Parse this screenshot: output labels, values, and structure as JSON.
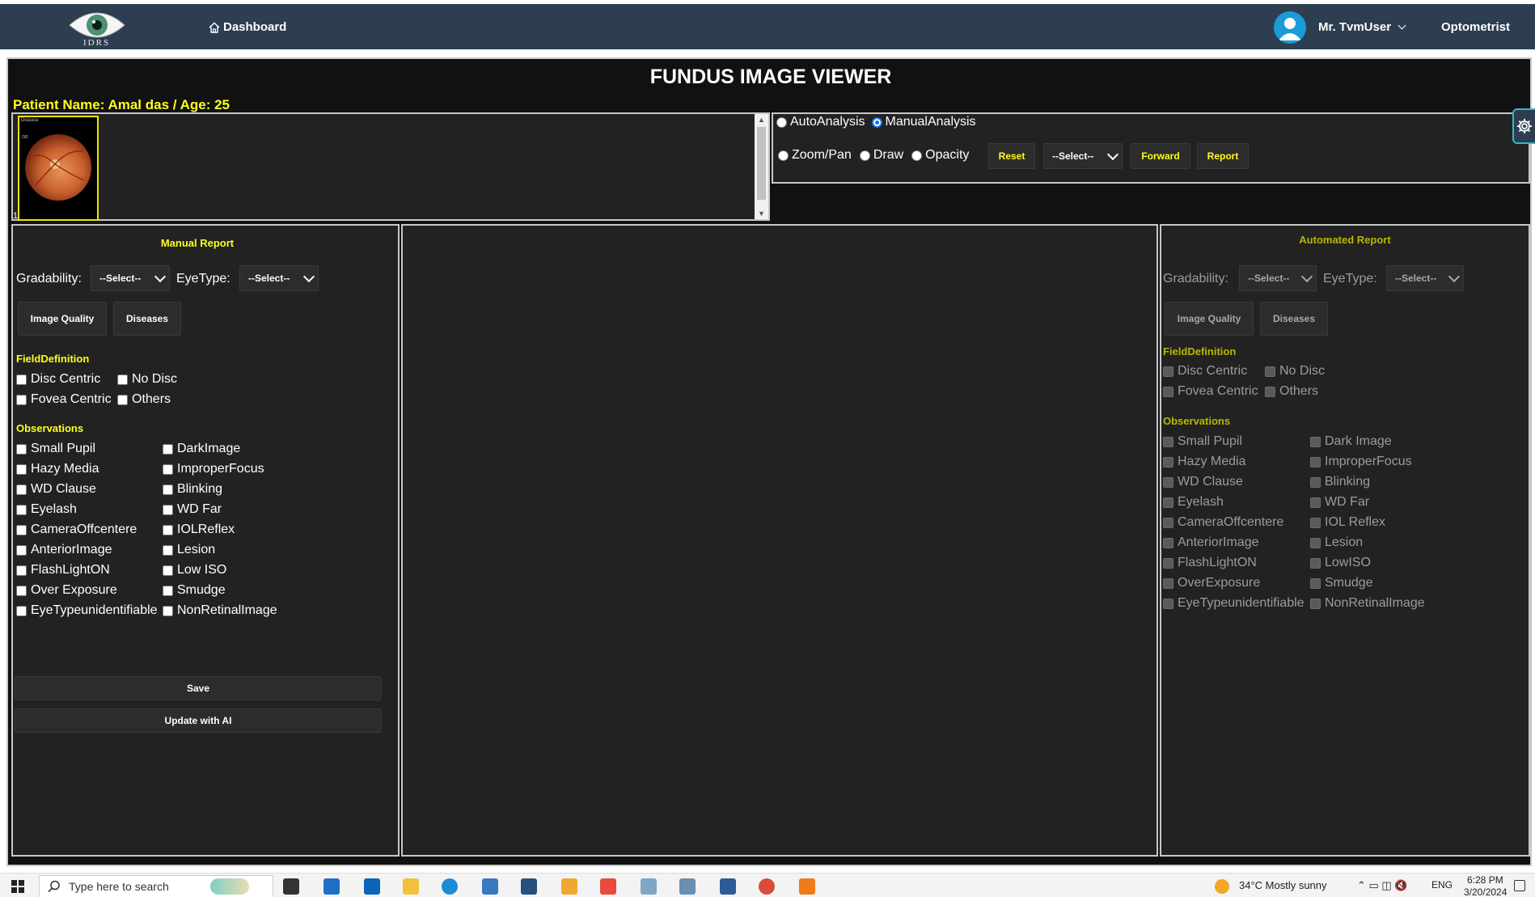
{
  "navbar": {
    "logo_text": "IDRS",
    "dashboard_label": "Dashboard",
    "user_name": "Mr. TvmUser",
    "role": "Optometrist"
  },
  "viewer": {
    "title": "FUNDUS IMAGE VIEWER",
    "patient_label": "Patient Name: Amal das / Age: 25",
    "thumbnails": [
      {
        "index": "1",
        "label": "Disease"
      }
    ]
  },
  "toolbar": {
    "analysis_modes": [
      {
        "label": "AutoAnalysis",
        "selected": false
      },
      {
        "label": "ManualAnalysis",
        "selected": true
      }
    ],
    "tools": [
      {
        "label": "Zoom/Pan",
        "selected": false
      },
      {
        "label": "Draw",
        "selected": false
      },
      {
        "label": "Opacity",
        "selected": false
      }
    ],
    "reset_label": "Reset",
    "select_value": "--Select--",
    "forward_label": "Forward",
    "report_label": "Report"
  },
  "manual_report": {
    "title": "Manual Report",
    "gradability_label": "Gradability:",
    "gradability_value": "--Select--",
    "eyetype_label": "EyeType:",
    "eyetype_value": "--Select--",
    "image_quality_label": "Image Quality",
    "diseases_label": "Diseases",
    "field_definition_title": "FieldDefinition",
    "field_definition": [
      "Disc Centric",
      "No Disc",
      "Fovea Centric",
      "Others"
    ],
    "observations_title": "Observations",
    "observations_col1": [
      "Small Pupil",
      "Hazy Media",
      "WD Clause",
      "Eyelash",
      "CameraOffcentere",
      "AnteriorImage",
      "FlashLightON",
      "Over Exposure",
      "EyeTypeunidentifiable"
    ],
    "observations_col2": [
      "DarkImage",
      "ImproperFocus",
      "Blinking",
      "WD Far",
      "IOLReflex",
      "Lesion",
      "Low ISO",
      "Smudge",
      "NonRetinalImage"
    ],
    "save_label": "Save",
    "update_ai_label": "Update with AI"
  },
  "automated_report": {
    "title": "Automated Report",
    "gradability_label": "Gradability:",
    "gradability_value": "--Select--",
    "eyetype_label": "EyeType:",
    "eyetype_value": "--Select--",
    "image_quality_label": "Image Quality",
    "diseases_label": "Diseases",
    "field_definition_title": "FieldDefinition",
    "field_definition": [
      "Disc Centric",
      "No Disc",
      "Fovea Centric",
      "Others"
    ],
    "observations_title": "Observations",
    "observations_col1": [
      "Small Pupil",
      "Hazy Media",
      "WD Clause",
      "Eyelash",
      "CameraOffcentere",
      "AnteriorImage",
      "FlashLightON",
      "OverExposure",
      "EyeTypeunidentifiable"
    ],
    "observations_col2": [
      "Dark Image",
      "ImproperFocus",
      "Blinking",
      "WD Far",
      "IOL Reflex",
      "Lesion",
      "LowISO",
      "Smudge",
      "NonRetinalImage"
    ]
  },
  "taskbar": {
    "search_placeholder": "Type here to search",
    "weather": "34°C  Mostly sunny",
    "language": "ENG",
    "time": "6:28 PM",
    "date": "3/20/2024"
  },
  "colors": {
    "navbar": "#2c3e50",
    "accent_yellow": "#ffff1e",
    "panel_bg": "#222222",
    "frame_bg": "#111111"
  }
}
